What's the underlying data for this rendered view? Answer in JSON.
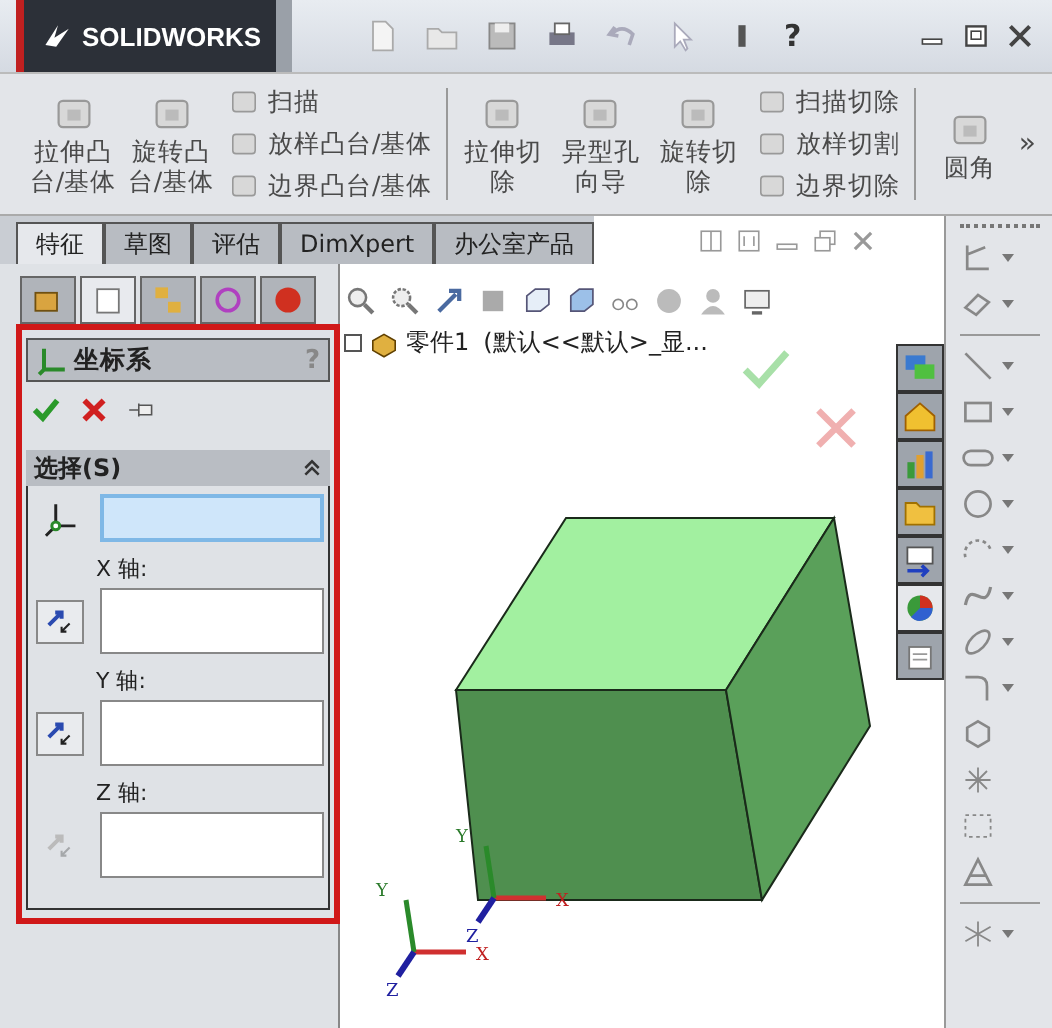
{
  "title_bar": {
    "logo": "SOLIDWORKS",
    "help": "?"
  },
  "ribbon": {
    "groups": [
      {
        "items": [
          {
            "kind": "large",
            "label": "拉伸凸台/基体"
          },
          {
            "kind": "large",
            "label": "旋转凸台/基体"
          },
          {
            "kind": "stack",
            "labels": [
              "扫描",
              "放样凸台/基体",
              "边界凸台/基体"
            ]
          }
        ]
      },
      {
        "items": [
          {
            "kind": "large",
            "label": "拉伸切除"
          },
          {
            "kind": "large",
            "label": "异型孔向导"
          },
          {
            "kind": "large",
            "label": "旋转切除"
          },
          {
            "kind": "stack",
            "labels": [
              "扫描切除",
              "放样切割",
              "边界切除"
            ]
          }
        ]
      },
      {
        "items": [
          {
            "kind": "large",
            "label": "圆角"
          }
        ]
      }
    ],
    "overflow": "»"
  },
  "tabs": [
    {
      "label": "特征",
      "selected": true
    },
    {
      "label": "草图",
      "selected": false
    },
    {
      "label": "评估",
      "selected": false
    },
    {
      "label": "DimXpert",
      "selected": false
    },
    {
      "label": "办公室产品",
      "selected": false
    }
  ],
  "task_pane": [
    {
      "selected": false
    },
    {
      "selected": false
    },
    {
      "selected": false
    },
    {
      "selected": false
    },
    {
      "selected": false
    },
    {
      "selected": true
    },
    {
      "selected": false
    }
  ],
  "panel_tabs": [
    {
      "selected": false
    },
    {
      "selected": true
    },
    {
      "selected": false
    },
    {
      "selected": false
    },
    {
      "selected": false
    }
  ],
  "property_manager": {
    "title": "坐标系",
    "help": "?",
    "section": {
      "title": "选择(S)",
      "expanded": true
    },
    "fields": [
      {
        "kind": "origin",
        "active": true
      },
      {
        "kind": "axis",
        "label": "X 轴:",
        "active": false,
        "disabled": false
      },
      {
        "kind": "axis",
        "label": "Y 轴:",
        "active": false,
        "disabled": false
      },
      {
        "kind": "axis",
        "label": "Z 轴:",
        "active": false,
        "disabled": true
      }
    ]
  },
  "graphics": {
    "tree": {
      "name": "零件1",
      "config": "(默认<<默认>_显..."
    },
    "triads": [
      {
        "x": "X",
        "y": "Y",
        "z": "Z"
      },
      {
        "x": "X",
        "y": "Y",
        "z": "Z"
      }
    ]
  }
}
